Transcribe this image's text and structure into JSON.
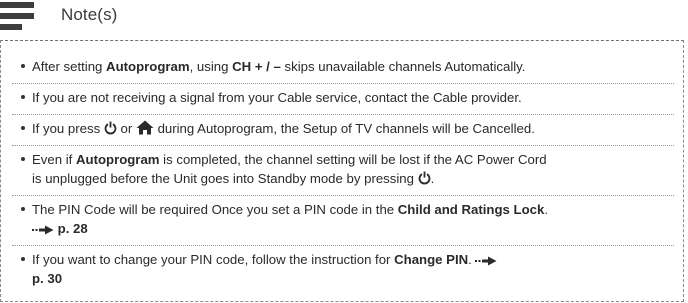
{
  "header": {
    "title": "Note(s)",
    "icon": "note-lines-icon"
  },
  "notes": [
    {
      "p1": "After setting ",
      "b1": "Autoprogram",
      "p2": ", using ",
      "b2": "CH + / –",
      "p3": " skips unavailable channels Automatically."
    },
    {
      "text": "If you are not receiving a signal from your Cable service, contact the Cable provider."
    },
    {
      "p1": "If you press ",
      "icon1": "power-icon",
      "p2": " or ",
      "icon2": "home-icon",
      "p3": " during Autoprogram, the Setup of TV channels will be Cancelled."
    },
    {
      "p1": "Even if ",
      "b1": "Autoprogram",
      "p2": " is completed, the channel setting will be lost if the AC Power Cord",
      "p3": "is unplugged before the Unit goes into Standby mode by pressing ",
      "icon1": "power-icon",
      "p4": "."
    },
    {
      "p1": "The PIN Code will be required Once you set a PIN code in the ",
      "b1": "Child and Ratings Lock",
      "p2": ".",
      "ref": "p. 28"
    },
    {
      "p1": "If you want to change your PIN code, follow the instruction for ",
      "b1": "Change PIN",
      "p2": ".",
      "ref": "p. 30"
    }
  ],
  "colors": {
    "text": "#2a2a2a",
    "icon": "#3d3d3d",
    "separator": "#9a9a9a"
  }
}
